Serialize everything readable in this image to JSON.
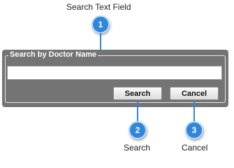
{
  "callouts": {
    "search_field": {
      "number": "1",
      "label": "Search Text Field"
    },
    "search_button": {
      "number": "2",
      "label": "Search"
    },
    "cancel_button": {
      "number": "3",
      "label": "Cancel"
    }
  },
  "panel": {
    "legend": "Search by Doctor Name",
    "input_value": "",
    "search_label": "Search",
    "cancel_label": "Cancel"
  },
  "colors": {
    "badge": "#2f86dd",
    "panel": "#747474"
  }
}
